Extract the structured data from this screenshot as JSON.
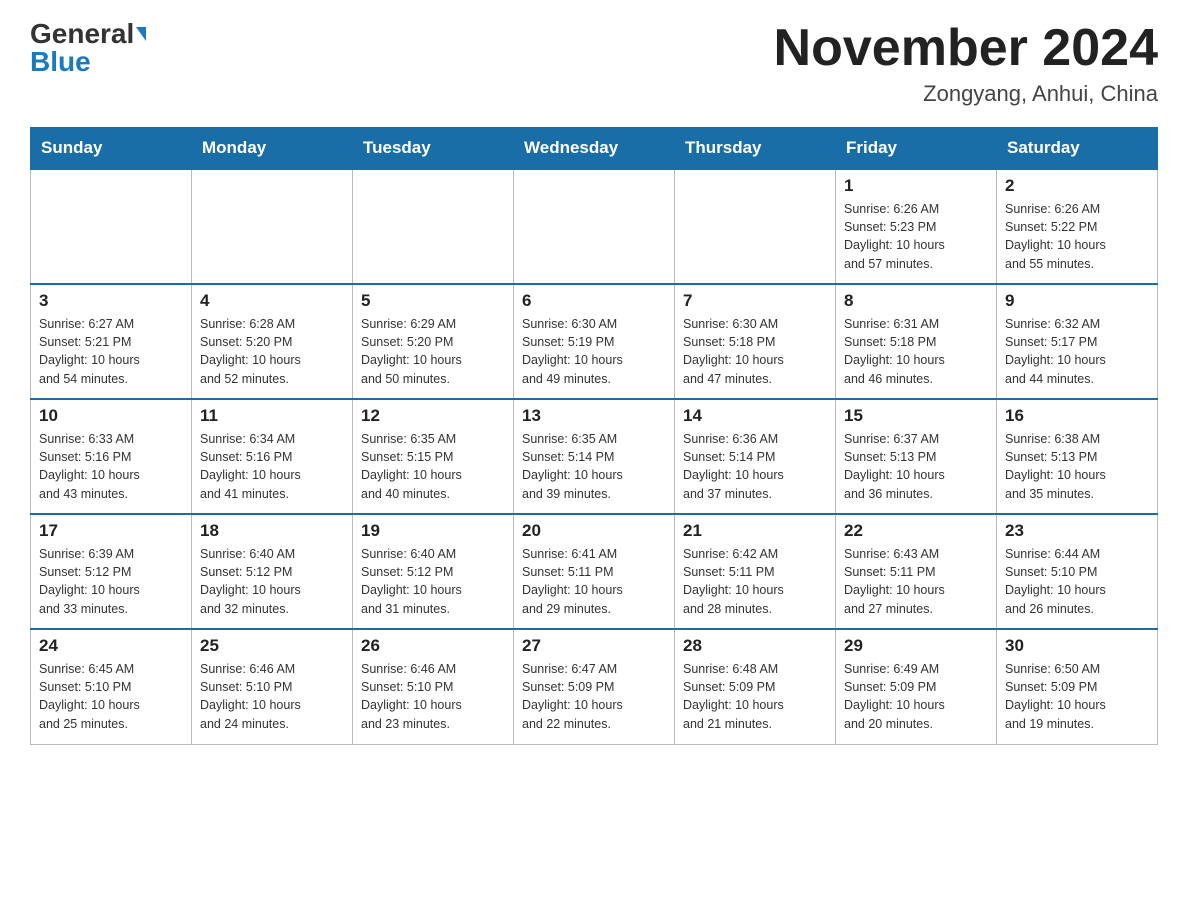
{
  "header": {
    "logo_general": "General",
    "logo_blue": "Blue",
    "month_title": "November 2024",
    "location": "Zongyang, Anhui, China"
  },
  "weekdays": [
    "Sunday",
    "Monday",
    "Tuesday",
    "Wednesday",
    "Thursday",
    "Friday",
    "Saturday"
  ],
  "weeks": [
    [
      {
        "day": "",
        "info": ""
      },
      {
        "day": "",
        "info": ""
      },
      {
        "day": "",
        "info": ""
      },
      {
        "day": "",
        "info": ""
      },
      {
        "day": "",
        "info": ""
      },
      {
        "day": "1",
        "info": "Sunrise: 6:26 AM\nSunset: 5:23 PM\nDaylight: 10 hours\nand 57 minutes."
      },
      {
        "day": "2",
        "info": "Sunrise: 6:26 AM\nSunset: 5:22 PM\nDaylight: 10 hours\nand 55 minutes."
      }
    ],
    [
      {
        "day": "3",
        "info": "Sunrise: 6:27 AM\nSunset: 5:21 PM\nDaylight: 10 hours\nand 54 minutes."
      },
      {
        "day": "4",
        "info": "Sunrise: 6:28 AM\nSunset: 5:20 PM\nDaylight: 10 hours\nand 52 minutes."
      },
      {
        "day": "5",
        "info": "Sunrise: 6:29 AM\nSunset: 5:20 PM\nDaylight: 10 hours\nand 50 minutes."
      },
      {
        "day": "6",
        "info": "Sunrise: 6:30 AM\nSunset: 5:19 PM\nDaylight: 10 hours\nand 49 minutes."
      },
      {
        "day": "7",
        "info": "Sunrise: 6:30 AM\nSunset: 5:18 PM\nDaylight: 10 hours\nand 47 minutes."
      },
      {
        "day": "8",
        "info": "Sunrise: 6:31 AM\nSunset: 5:18 PM\nDaylight: 10 hours\nand 46 minutes."
      },
      {
        "day": "9",
        "info": "Sunrise: 6:32 AM\nSunset: 5:17 PM\nDaylight: 10 hours\nand 44 minutes."
      }
    ],
    [
      {
        "day": "10",
        "info": "Sunrise: 6:33 AM\nSunset: 5:16 PM\nDaylight: 10 hours\nand 43 minutes."
      },
      {
        "day": "11",
        "info": "Sunrise: 6:34 AM\nSunset: 5:16 PM\nDaylight: 10 hours\nand 41 minutes."
      },
      {
        "day": "12",
        "info": "Sunrise: 6:35 AM\nSunset: 5:15 PM\nDaylight: 10 hours\nand 40 minutes."
      },
      {
        "day": "13",
        "info": "Sunrise: 6:35 AM\nSunset: 5:14 PM\nDaylight: 10 hours\nand 39 minutes."
      },
      {
        "day": "14",
        "info": "Sunrise: 6:36 AM\nSunset: 5:14 PM\nDaylight: 10 hours\nand 37 minutes."
      },
      {
        "day": "15",
        "info": "Sunrise: 6:37 AM\nSunset: 5:13 PM\nDaylight: 10 hours\nand 36 minutes."
      },
      {
        "day": "16",
        "info": "Sunrise: 6:38 AM\nSunset: 5:13 PM\nDaylight: 10 hours\nand 35 minutes."
      }
    ],
    [
      {
        "day": "17",
        "info": "Sunrise: 6:39 AM\nSunset: 5:12 PM\nDaylight: 10 hours\nand 33 minutes."
      },
      {
        "day": "18",
        "info": "Sunrise: 6:40 AM\nSunset: 5:12 PM\nDaylight: 10 hours\nand 32 minutes."
      },
      {
        "day": "19",
        "info": "Sunrise: 6:40 AM\nSunset: 5:12 PM\nDaylight: 10 hours\nand 31 minutes."
      },
      {
        "day": "20",
        "info": "Sunrise: 6:41 AM\nSunset: 5:11 PM\nDaylight: 10 hours\nand 29 minutes."
      },
      {
        "day": "21",
        "info": "Sunrise: 6:42 AM\nSunset: 5:11 PM\nDaylight: 10 hours\nand 28 minutes."
      },
      {
        "day": "22",
        "info": "Sunrise: 6:43 AM\nSunset: 5:11 PM\nDaylight: 10 hours\nand 27 minutes."
      },
      {
        "day": "23",
        "info": "Sunrise: 6:44 AM\nSunset: 5:10 PM\nDaylight: 10 hours\nand 26 minutes."
      }
    ],
    [
      {
        "day": "24",
        "info": "Sunrise: 6:45 AM\nSunset: 5:10 PM\nDaylight: 10 hours\nand 25 minutes."
      },
      {
        "day": "25",
        "info": "Sunrise: 6:46 AM\nSunset: 5:10 PM\nDaylight: 10 hours\nand 24 minutes."
      },
      {
        "day": "26",
        "info": "Sunrise: 6:46 AM\nSunset: 5:10 PM\nDaylight: 10 hours\nand 23 minutes."
      },
      {
        "day": "27",
        "info": "Sunrise: 6:47 AM\nSunset: 5:09 PM\nDaylight: 10 hours\nand 22 minutes."
      },
      {
        "day": "28",
        "info": "Sunrise: 6:48 AM\nSunset: 5:09 PM\nDaylight: 10 hours\nand 21 minutes."
      },
      {
        "day": "29",
        "info": "Sunrise: 6:49 AM\nSunset: 5:09 PM\nDaylight: 10 hours\nand 20 minutes."
      },
      {
        "day": "30",
        "info": "Sunrise: 6:50 AM\nSunset: 5:09 PM\nDaylight: 10 hours\nand 19 minutes."
      }
    ]
  ]
}
